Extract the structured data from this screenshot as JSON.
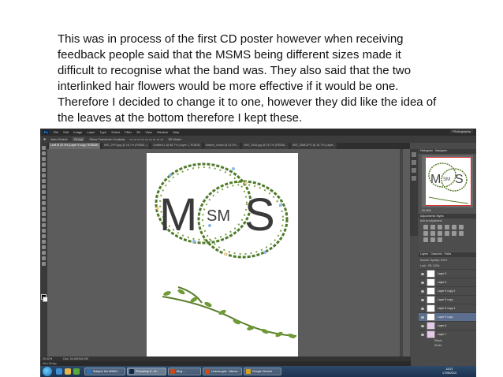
{
  "caption": {
    "lines": [
      "This was in process of the first CD poster however when receiving",
      "feedback people said that the MSMS being different sizes made it",
      "difficult to recognise what the band was. They also said that the two",
      "interlinked hair flowers would be more effective if it would be one.",
      "Therefore I decided to change it to one, however they did like the idea of",
      "the leaves at the bottom therefore I kept these."
    ]
  },
  "photoshop": {
    "menu": [
      "Ps",
      "File",
      "Edit",
      "Image",
      "Layer",
      "Type",
      "Select",
      "Filter",
      "3D",
      "View",
      "Window",
      "Help"
    ],
    "workspace": "Photography",
    "options": [
      "Auto-Select:",
      "Group",
      "Show Transform Controls",
      "3D Mode:"
    ],
    "tabs": [
      {
        "label": "Leaf M 20.4% (Layer 9 copy, RGB/8#)",
        "active": true
      },
      {
        "label": "IMG_2979.jpg @ 16.7% (RGB/8...)",
        "active": false
      },
      {
        "label": "Untitled-1 @ 66.7% (Layer 1, RGB/8)",
        "active": false
      },
      {
        "label": "flowers_crown @ 33.3%...",
        "active": false
      },
      {
        "label": "IMG_3445.jpg @ 16.7% (RGB/8...",
        "active": false
      },
      {
        "label": "IMG_3588.JPG @ 16.7% (Layer...",
        "active": false
      }
    ],
    "poster_text": {
      "big_m1": "M",
      "small_s": "SM",
      "big_s": "S"
    },
    "status": {
      "zoom": "20.42%",
      "doc": "Doc: 34.4M/164.2M"
    },
    "minibridge": "Mini Bridge",
    "panels": {
      "navigator_tabs": [
        "Histogram",
        "Navigator"
      ],
      "zoom": "20.42%",
      "adjustments_tabs": [
        "Adjustments",
        "Styles"
      ],
      "adjustments_hint": "Add an adjustment",
      "layers_tabs": [
        "Layers",
        "Channels",
        "Paths"
      ],
      "blend_mode": "Normal",
      "opacity": "Opacity: 100%",
      "fill": "Fill: 100%",
      "lock": "Lock:"
    },
    "layers": [
      {
        "name": "Layer 9",
        "selected": false
      },
      {
        "name": "Layer 5",
        "selected": false
      },
      {
        "name": "Layer 9 copy 2",
        "selected": false
      },
      {
        "name": "Layer 9 copy",
        "selected": false
      },
      {
        "name": "Layer 9 copy 3",
        "selected": false
      },
      {
        "name": "Layer 9 copy",
        "selected": true
      },
      {
        "name": "Layer 6",
        "selected": false
      },
      {
        "name": "Layer 7",
        "selected": false
      }
    ],
    "layer_effects": [
      "Effects",
      "Stroke"
    ]
  },
  "taskbar": {
    "tasks": [
      {
        "label": "Subject: the MSMS...",
        "color": "#2f6fb5"
      },
      {
        "label": "Photoshop 8 - M...",
        "color": "#0b2a47"
      },
      {
        "label": "Blog ...",
        "color": "#c94b1a"
      },
      {
        "label": "Leaves.pptx - Micros...",
        "color": "#c94b1a"
      },
      {
        "label": "Google Chrome",
        "color": "#d8a21b"
      }
    ],
    "time": "18:21",
    "date": "17/06/2013"
  }
}
